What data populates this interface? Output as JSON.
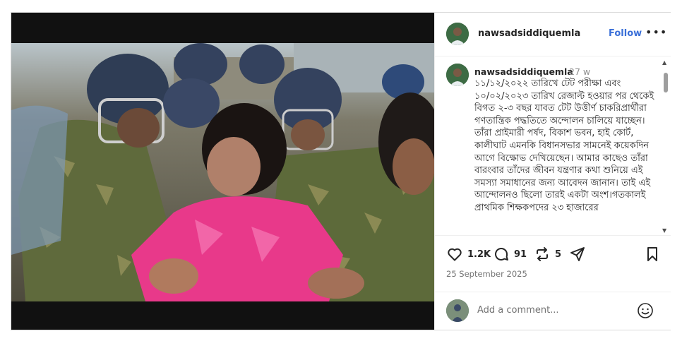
{
  "post": {
    "author": "nawsadsiddiquemla",
    "follow_label": "Follow",
    "more_label": "•••",
    "caption": {
      "username": "nawsadsiddiquemla",
      "time_ago": "27 w",
      "text": "১১/১২/২০২২ তারিখে টেট পরীক্ষা এবং ১০/০২/২০২৩ তারিখ রেজাল্ট হওয়ার পর থেকেই বিগত ২-৩ বছর যাবত টেট উত্তীর্ণ চাকরিপ্রার্থীরা গণতান্ত্রিক পদ্ধতিতে অন্দোলন চালিয়ে যাচ্ছেন। তাঁরা প্রাইমারী পর্ষদ, বিকাশ ভবন, হাই কোর্ট, কালীঘাট এমনকি বিধানসভার সামনেই কয়েকদিন আগে বিক্ষোভ দেখিয়েছেন। আমার কাছেও তাঁরা বারংবার তাঁদের জীবন যন্ত্রণার কথা শুনিয়ে এই সমস্যা সমাধানের জন্য আবেদন জানান। তাই এই আন্দোলনও ছিলো তারই একটা অংশ।গতকালই প্রাথমিক শিক্ষকপদের ২৩ হাজারের"
    },
    "likes": "1.2K",
    "comments_count": "91",
    "reposts": "5",
    "date": "25 September 2025",
    "comment_placeholder": "Add a comment..."
  },
  "icons": {
    "like": "heart-icon",
    "comment": "comment-bubble-icon",
    "repost": "repost-icon",
    "share": "send-icon",
    "save": "bookmark-icon",
    "emoji": "emoji-icon"
  },
  "colors": {
    "follow": "#3a6fd8",
    "uniform": "#5f6a3c",
    "saree": "#e8398a"
  }
}
